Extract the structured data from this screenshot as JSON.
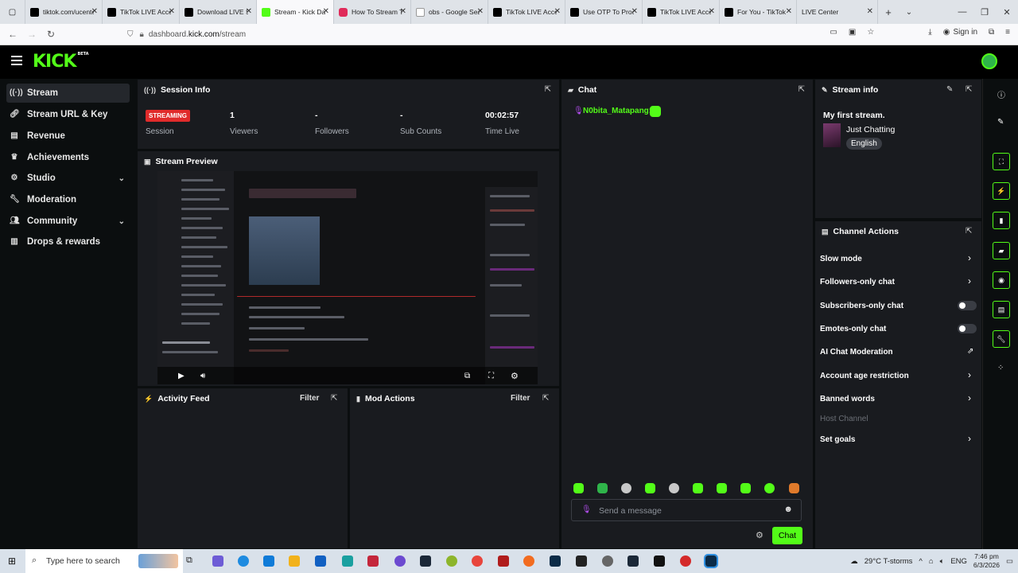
{
  "browser": {
    "tabs": [
      {
        "title": "tiktok.com/ucenter"
      },
      {
        "title": "TikTok LIVE Access"
      },
      {
        "title": "Download LIVE Studio"
      },
      {
        "title": "Stream - Kick Dashboard"
      },
      {
        "title": "How To Stream TikTok"
      },
      {
        "title": "obs - Google Search"
      },
      {
        "title": "TikTok LIVE Access"
      },
      {
        "title": "Use OTP To Proceed"
      },
      {
        "title": "TikTok LIVE Access"
      },
      {
        "title": "For You - TikTok"
      },
      {
        "title": "LIVE Center"
      }
    ],
    "url_prefix": "dashboard.",
    "url_domain": "kick.com",
    "url_path": "/stream",
    "sign_in": "Sign in"
  },
  "kick": {
    "logo": "KICK",
    "logo_badge": "BETA"
  },
  "sidebar": {
    "items": [
      {
        "label": "Stream",
        "icon": "broadcast-icon"
      },
      {
        "label": "Stream URL & Key",
        "icon": "link-icon"
      },
      {
        "label": "Revenue",
        "icon": "chart-icon"
      },
      {
        "label": "Achievements",
        "icon": "trophy-icon"
      },
      {
        "label": "Studio",
        "icon": "gear-icon"
      },
      {
        "label": "Moderation",
        "icon": "wrench-icon"
      },
      {
        "label": "Community",
        "icon": "users-icon"
      },
      {
        "label": "Drops & rewards",
        "icon": "stats-icon"
      }
    ]
  },
  "session": {
    "title": "Session Info",
    "status_badge": "STREAMING",
    "session_label": "Session",
    "viewers_value": "1",
    "viewers_label": "Viewers",
    "followers_value": "-",
    "followers_label": "Followers",
    "subs_value": "-",
    "subs_label": "Sub Counts",
    "time_value": "00:02:57",
    "time_label": "Time Live"
  },
  "preview": {
    "title": "Stream Preview"
  },
  "activity": {
    "title": "Activity Feed",
    "filter": "Filter"
  },
  "mod": {
    "title": "Mod Actions",
    "filter": "Filter"
  },
  "chat": {
    "title": "Chat",
    "username": "N0bita_Matapang:",
    "input_placeholder": "Send a message",
    "send_label": "Chat"
  },
  "stream_info": {
    "title": "Stream info",
    "stream_title": "My first stream.",
    "category": "Just Chatting",
    "language": "English"
  },
  "channel_actions": {
    "title": "Channel Actions",
    "items": [
      {
        "label": "Slow mode",
        "kind": "chevron"
      },
      {
        "label": "Followers-only chat",
        "kind": "chevron"
      },
      {
        "label": "Subscribers-only chat",
        "kind": "toggle",
        "enabled": false
      },
      {
        "label": "Emotes-only chat",
        "kind": "toggle",
        "enabled": false
      },
      {
        "label": "AI Chat Moderation",
        "kind": "external"
      },
      {
        "label": "Account age restriction",
        "kind": "chevron"
      },
      {
        "label": "Banned words",
        "kind": "chevron"
      },
      {
        "label": "Host Channel",
        "kind": "disabled"
      },
      {
        "label": "Set goals",
        "kind": "chevron"
      }
    ]
  },
  "taskbar": {
    "search_placeholder": "Type here to search",
    "weather": "29°C  T-storms",
    "lang": "ENG",
    "time": "7:46 pm",
    "date": "6/3/2026"
  },
  "colors": {
    "accent": "#53fc18",
    "live_red": "#e02b2b",
    "panel": "#191b1f"
  }
}
